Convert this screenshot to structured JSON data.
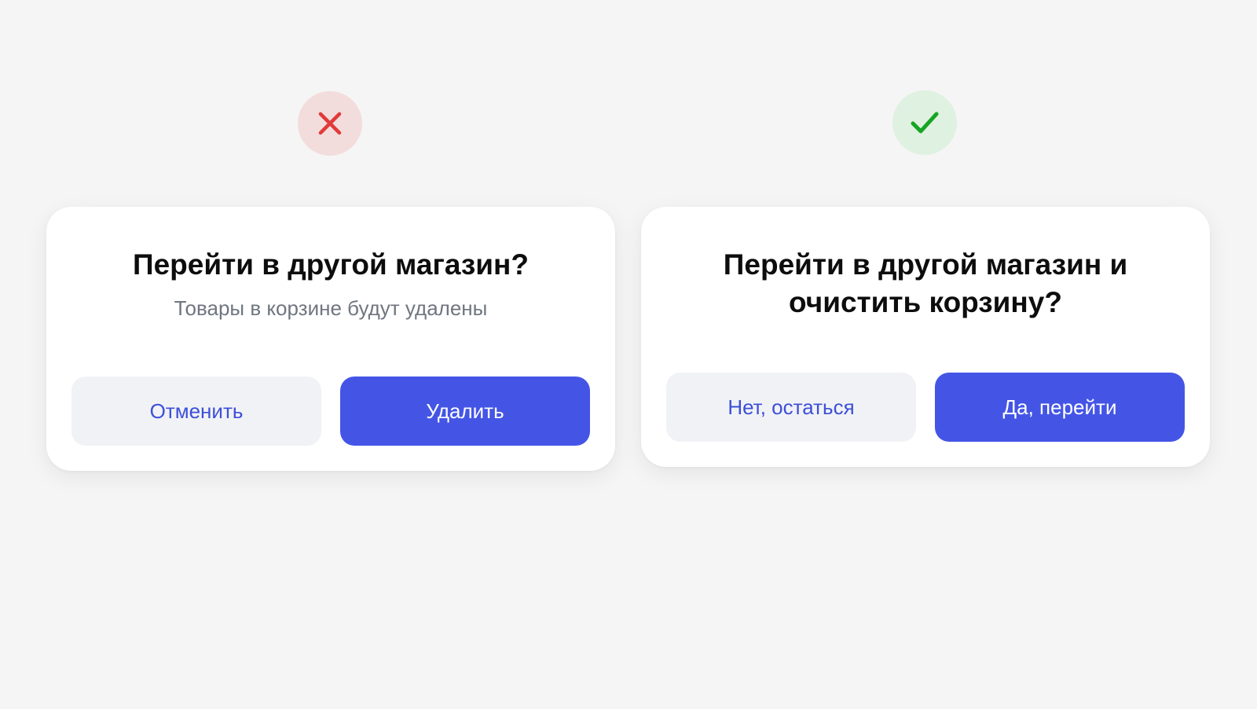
{
  "bad_example": {
    "icon": "cross-icon",
    "icon_color": "#e03a3a",
    "badge_color": "#f3dcdc",
    "title": "Перейти в другой магазин?",
    "subtitle": "Товары в корзине будут удалены",
    "cancel_label": "Отменить",
    "confirm_label": "Удалить"
  },
  "good_example": {
    "icon": "check-icon",
    "icon_color": "#16a523",
    "badge_color": "#dff1e1",
    "title": "Перейти в другой магазин и очистить корзину?",
    "cancel_label": "Нет, остаться",
    "confirm_label": "Да, перейти"
  },
  "colors": {
    "background": "#f5f5f5",
    "primary_button": "#4455e6",
    "secondary_button": "#f1f2f5",
    "secondary_text": "#3d4fd9",
    "subtitle_text": "#6f7680"
  }
}
